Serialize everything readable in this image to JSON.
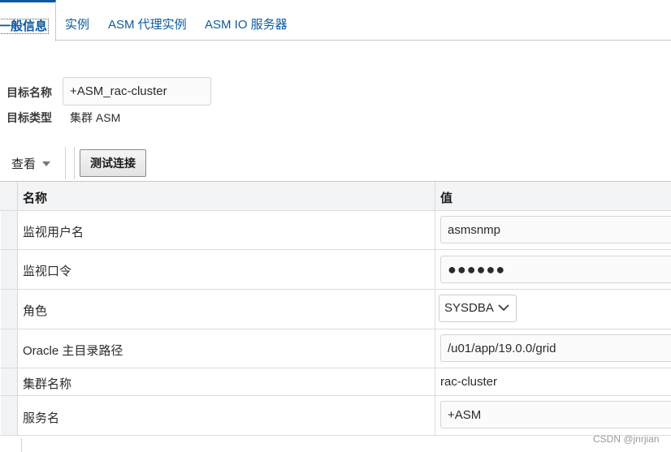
{
  "tabs": [
    {
      "label": "一般信息"
    },
    {
      "label": "实例"
    },
    {
      "label": "ASM 代理实例"
    },
    {
      "label": "ASM IO 服务器"
    }
  ],
  "target": {
    "name_label": "目标名称",
    "name_value": "+ASM_rac-cluster",
    "type_label": "目标类型",
    "type_value": "集群 ASM"
  },
  "toolbar": {
    "view_label": "查看",
    "test_button": "测试连接"
  },
  "table": {
    "headers": {
      "name": "名称",
      "value": "值"
    },
    "rows": [
      {
        "name": "监视用户名",
        "value": "asmsnmp"
      },
      {
        "name": "监视口令",
        "value": "●●●●●●"
      },
      {
        "name": "角色",
        "value": "SYSDBA"
      },
      {
        "name": "Oracle 主目录路径",
        "value": "/u01/app/19.0.0/grid"
      },
      {
        "name": "集群名称",
        "value": "rac-cluster"
      },
      {
        "name": "服务名",
        "value": "+ASM"
      }
    ]
  },
  "watermark": "CSDN @jnrjian",
  "colors": {
    "accent": "#0b5a9e",
    "header_bg": "#f3f4f6"
  }
}
